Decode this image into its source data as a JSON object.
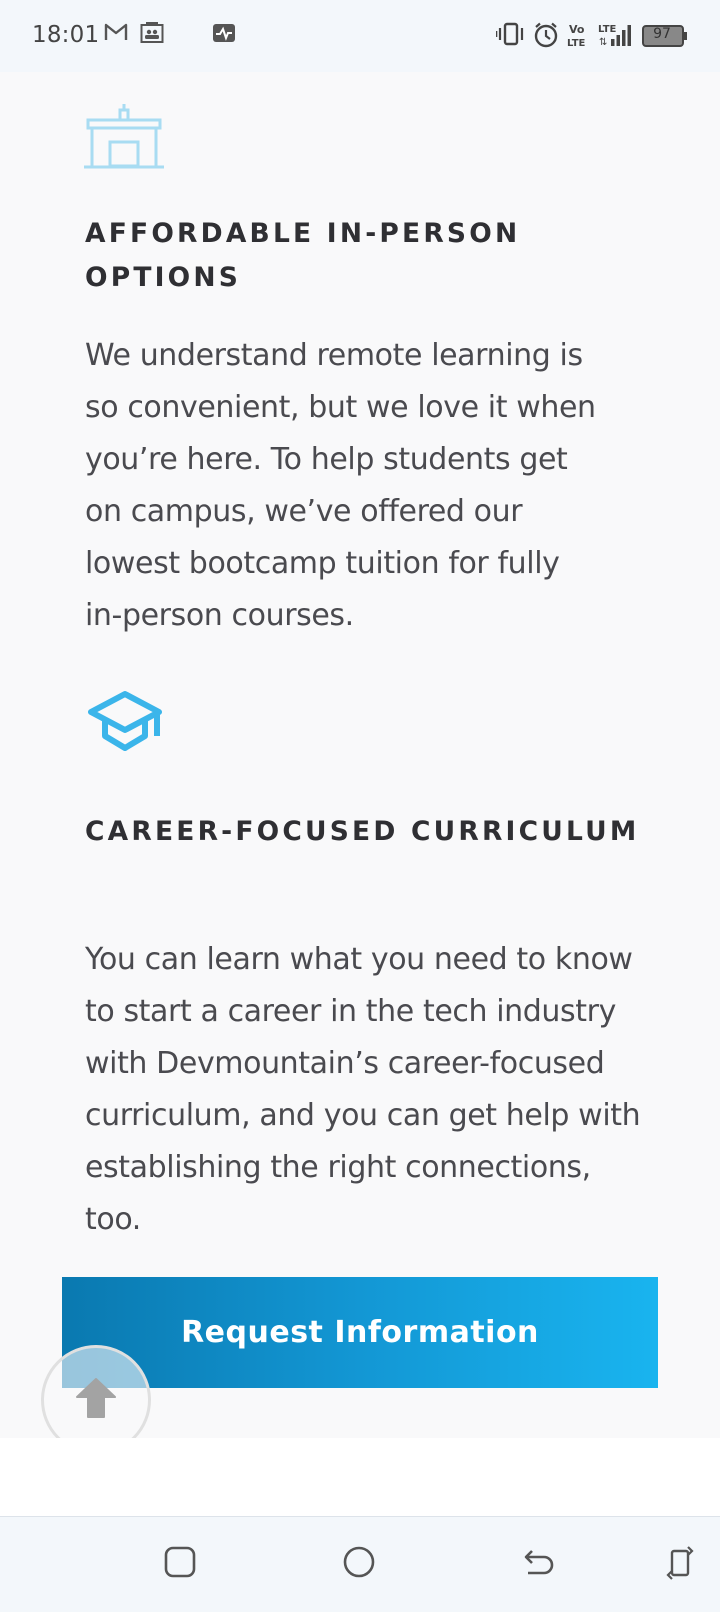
{
  "status_bar": {
    "time": "18:01",
    "icons": [
      "gmail-icon",
      "contacts-card-icon",
      "activity-icon",
      "vibrate-icon",
      "alarm-icon",
      "volte-icon",
      "lte-signal-icon"
    ],
    "battery": "97"
  },
  "features": [
    {
      "icon": "building-icon",
      "title": "AFFORDABLE IN-PERSON OPTIONS",
      "title_line1": "AFFORDABLE IN-PERSON",
      "title_line2": "OPTIONS",
      "body_lines": [
        "We understand remote learning is",
        "so convenient, but we love it when",
        "you’re here. To help students get",
        "on campus, we’ve offered our",
        "lowest bootcamp tuition for fully",
        "in-person courses."
      ]
    },
    {
      "icon": "graduation-cap-icon",
      "title": "CAREER-FOCUSED CURRICULUM",
      "body_lines": [
        "You can learn what you need to know",
        "to start a career in the tech industry",
        "with Devmountain’s career-focused",
        "curriculum, and you can get help with",
        "establishing the right connections,",
        "too."
      ]
    }
  ],
  "cta": {
    "label": "Request Information"
  },
  "scroll_top": {
    "icon": "arrow-up-icon"
  },
  "nav_bar": {
    "buttons": [
      "recents-square-icon",
      "home-circle-icon",
      "back-arrow-icon",
      "rotate-screen-icon"
    ]
  },
  "colors": {
    "accent": "#19b4ef",
    "accent_dark": "#0a79b0",
    "icon_light_blue": "#a8dcf2",
    "icon_blue": "#3bb5ea",
    "text": "#4a4a4f",
    "heading": "#2f2f33"
  }
}
